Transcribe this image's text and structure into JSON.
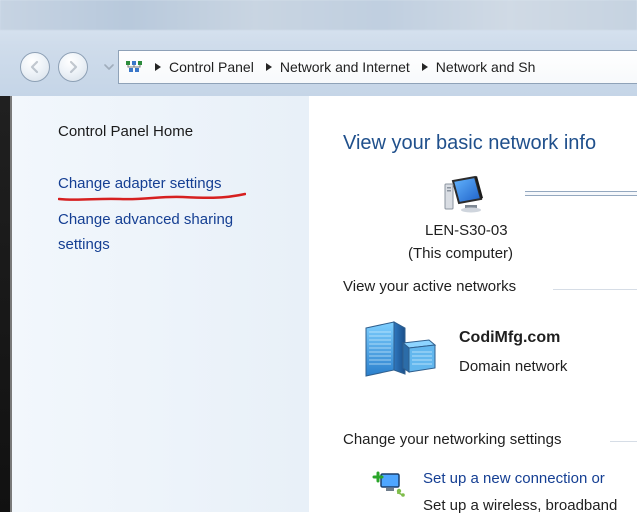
{
  "breadcrumbs": [
    "Control Panel",
    "Network and Internet",
    "Network and Sh"
  ],
  "icons": {
    "back": "back-arrow-icon",
    "forward": "forward-arrow-icon",
    "history": "chevron-down-icon",
    "address": "network-folder-icon",
    "computer": "computer-icon",
    "domain_network": "domain-network-icon",
    "setup": "setup-connection-icon"
  },
  "sidebar": {
    "home": "Control Panel Home",
    "change_adapter": "Change adapter settings",
    "change_sharing": "Change advanced sharing settings"
  },
  "main": {
    "heading": "View your basic network info",
    "computer_name": "LEN-S30-03",
    "computer_subtitle": "(This computer)",
    "active_networks_title": "View your active networks",
    "network_name": "CodiMfg.com",
    "network_type": "Domain network",
    "change_settings_title": "Change your networking settings",
    "setup_link": "Set up a new connection or",
    "setup_desc": "Set up a wireless, broadband"
  },
  "colors": {
    "link": "#153f93",
    "heading": "#20508c",
    "annotation_red": "#d62020"
  }
}
